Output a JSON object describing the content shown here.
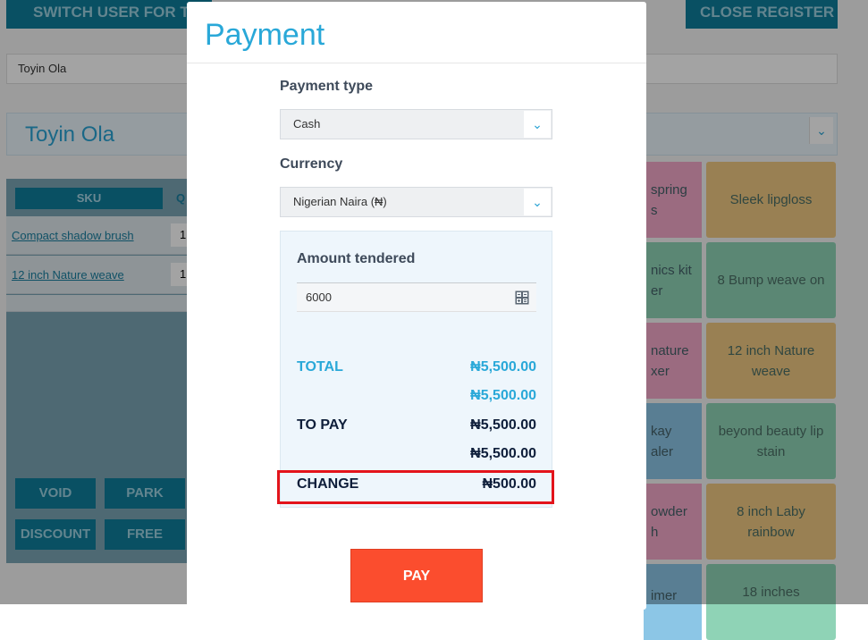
{
  "background": {
    "switch_user_label": "SWITCH USER FOR TI",
    "close_register_label": "CLOSE REGISTER",
    "customer_box_text": "Toyin Ola",
    "customer_select_name": "Toyin Ola",
    "cart": {
      "col_sku": "SKU",
      "col_qty": "Q",
      "rows": [
        {
          "name": "Compact shadow brush",
          "qty": "1"
        },
        {
          "name": "12 inch Nature weave",
          "qty": "1"
        }
      ]
    },
    "actions": {
      "void": "VOID",
      "park": "PARK",
      "discount": "DISCOUNT",
      "free": "FREE"
    },
    "tiles": [
      {
        "label": "Sleek lipgloss",
        "color": "#f0c882"
      },
      {
        "label": "8 Bump weave on",
        "color": "#8fd3b6"
      },
      {
        "label": "12 inch Nature weave",
        "color": "#f0c882"
      },
      {
        "label": "beyond beauty lip stain",
        "color": "#8fd3b6"
      },
      {
        "label": "8 inch Laby rainbow",
        "color": "#f0c882"
      },
      {
        "label": "18 inches",
        "color": "#8fd3b6"
      }
    ],
    "tile_fragments": [
      "spring\ns",
      "nics kit\ner",
      "nature\nxer",
      "kay\naler",
      "owder\nh",
      "imer"
    ]
  },
  "modal": {
    "title": "Payment",
    "payment_type_label": "Payment type",
    "payment_type_value": "Cash",
    "currency_label": "Currency",
    "currency_value": "Nigerian Naira (₦)",
    "amount_tendered_label": "Amount tendered",
    "amount_tendered_value": "6000",
    "summary": {
      "total_label": "TOTAL",
      "total_value": "₦5,500.00",
      "total_sub_value": "₦5,500.00",
      "to_pay_label": "TO PAY",
      "to_pay_value": "₦5,500.00",
      "to_pay_sub_value": "₦5,500.00",
      "change_label": "CHANGE",
      "change_value": "₦500.00"
    },
    "pay_label": "PAY"
  },
  "colors": {
    "accent": "#29a8d8",
    "pay_button": "#fb4d2e",
    "highlight": "#e3141b",
    "dark_text": "#0e1e3a"
  },
  "icons": {
    "select_arrow": "chevron-down-icon",
    "calculator": "calculator-icon"
  }
}
